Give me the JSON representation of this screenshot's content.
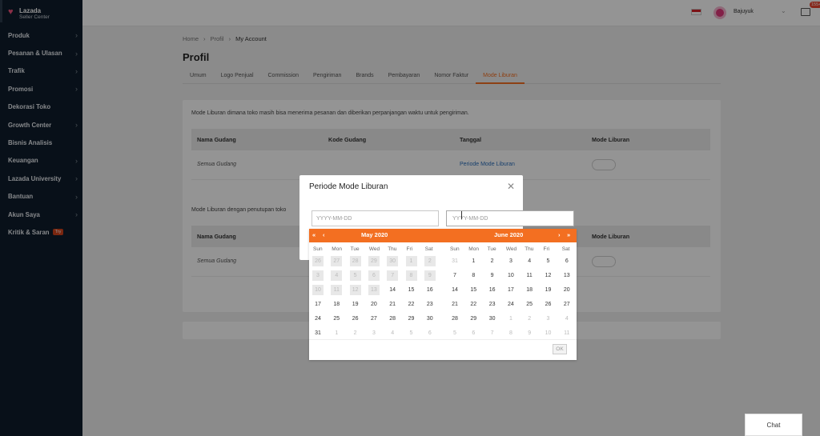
{
  "brand": {
    "line1": "Lazada",
    "line2": "Seller Center"
  },
  "sidebar": {
    "items": [
      {
        "label": "Produk",
        "chevron": true
      },
      {
        "label": "Pesanan & Ulasan",
        "chevron": true
      },
      {
        "label": "Trafik",
        "chevron": true
      },
      {
        "label": "Promosi",
        "chevron": true
      },
      {
        "label": "Dekorasi Toko",
        "chevron": false
      },
      {
        "label": "Growth Center",
        "chevron": true
      },
      {
        "label": "Bisnis Analisis",
        "chevron": false
      },
      {
        "label": "Keuangan",
        "chevron": true
      },
      {
        "label": "Lazada University",
        "chevron": true
      },
      {
        "label": "Bantuan",
        "chevron": true
      },
      {
        "label": "Akun Saya",
        "chevron": true
      },
      {
        "label": "Kritik & Saran",
        "chevron": false,
        "badge": "Try"
      }
    ]
  },
  "header": {
    "username": "Bajuyuk",
    "mail_badge": "155+"
  },
  "breadcrumb": {
    "home": "Home",
    "profil": "Profil",
    "current": "My Account"
  },
  "page": {
    "title": "Profil",
    "tabs": [
      "Umum",
      "Logo Penjual",
      "Commission",
      "Pengiriman",
      "Brands",
      "Pembayaran",
      "Nomor Faktur",
      "Mode Liburan"
    ],
    "active_tab": "Mode Liburan"
  },
  "section1": {
    "description": "Mode Liburan dimana toko masih bisa menerima pesanan dan diberikan perpanjangan waktu untuk pengiriman.",
    "columns": [
      "Nama Gudang",
      "Kode Gudang",
      "Tanggal",
      "Mode Liburan"
    ],
    "row": {
      "gudang": "Semua Gudang",
      "tanggal": "Periode Mode Liburan"
    }
  },
  "section2": {
    "description": "Mode Liburan dengan penutupan toko",
    "columns": [
      "Nama Gudang",
      "Mode Liburan"
    ],
    "row": {
      "gudang": "Semua Gudang"
    }
  },
  "dialog": {
    "title": "Periode Mode Liburan",
    "start_placeholder": "YYYY-MM-DD",
    "end_placeholder": "YYYY-MM-DD"
  },
  "calendar": {
    "left_month": "May  2020",
    "right_month": "June  2020",
    "weekdays": [
      "Sun",
      "Mon",
      "Tue",
      "Wed",
      "Thu",
      "Fri",
      "Sat"
    ],
    "left_days": [
      [
        "26",
        "27",
        "28",
        "29",
        "30",
        "1",
        "2"
      ],
      [
        "3",
        "4",
        "5",
        "6",
        "7",
        "8",
        "9"
      ],
      [
        "10",
        "11",
        "12",
        "13",
        "14",
        "15",
        "16"
      ],
      [
        "17",
        "18",
        "19",
        "20",
        "21",
        "22",
        "23"
      ],
      [
        "24",
        "25",
        "26",
        "27",
        "28",
        "29",
        "30"
      ],
      [
        "31",
        "1",
        "2",
        "3",
        "4",
        "5",
        "6"
      ]
    ],
    "right_days": [
      [
        "31",
        "1",
        "2",
        "3",
        "4",
        "5",
        "6"
      ],
      [
        "7",
        "8",
        "9",
        "10",
        "11",
        "12",
        "13"
      ],
      [
        "14",
        "15",
        "16",
        "17",
        "18",
        "19",
        "20"
      ],
      [
        "21",
        "22",
        "23",
        "24",
        "25",
        "26",
        "27"
      ],
      [
        "28",
        "29",
        "30",
        "1",
        "2",
        "3",
        "4"
      ],
      [
        "5",
        "6",
        "7",
        "8",
        "9",
        "10",
        "11"
      ]
    ],
    "ok_label": "OK"
  },
  "chat_label": "Chat",
  "colors": {
    "accent": "#f36f21",
    "sidebar": "#0e1d2b",
    "link": "#2a6ebb"
  }
}
